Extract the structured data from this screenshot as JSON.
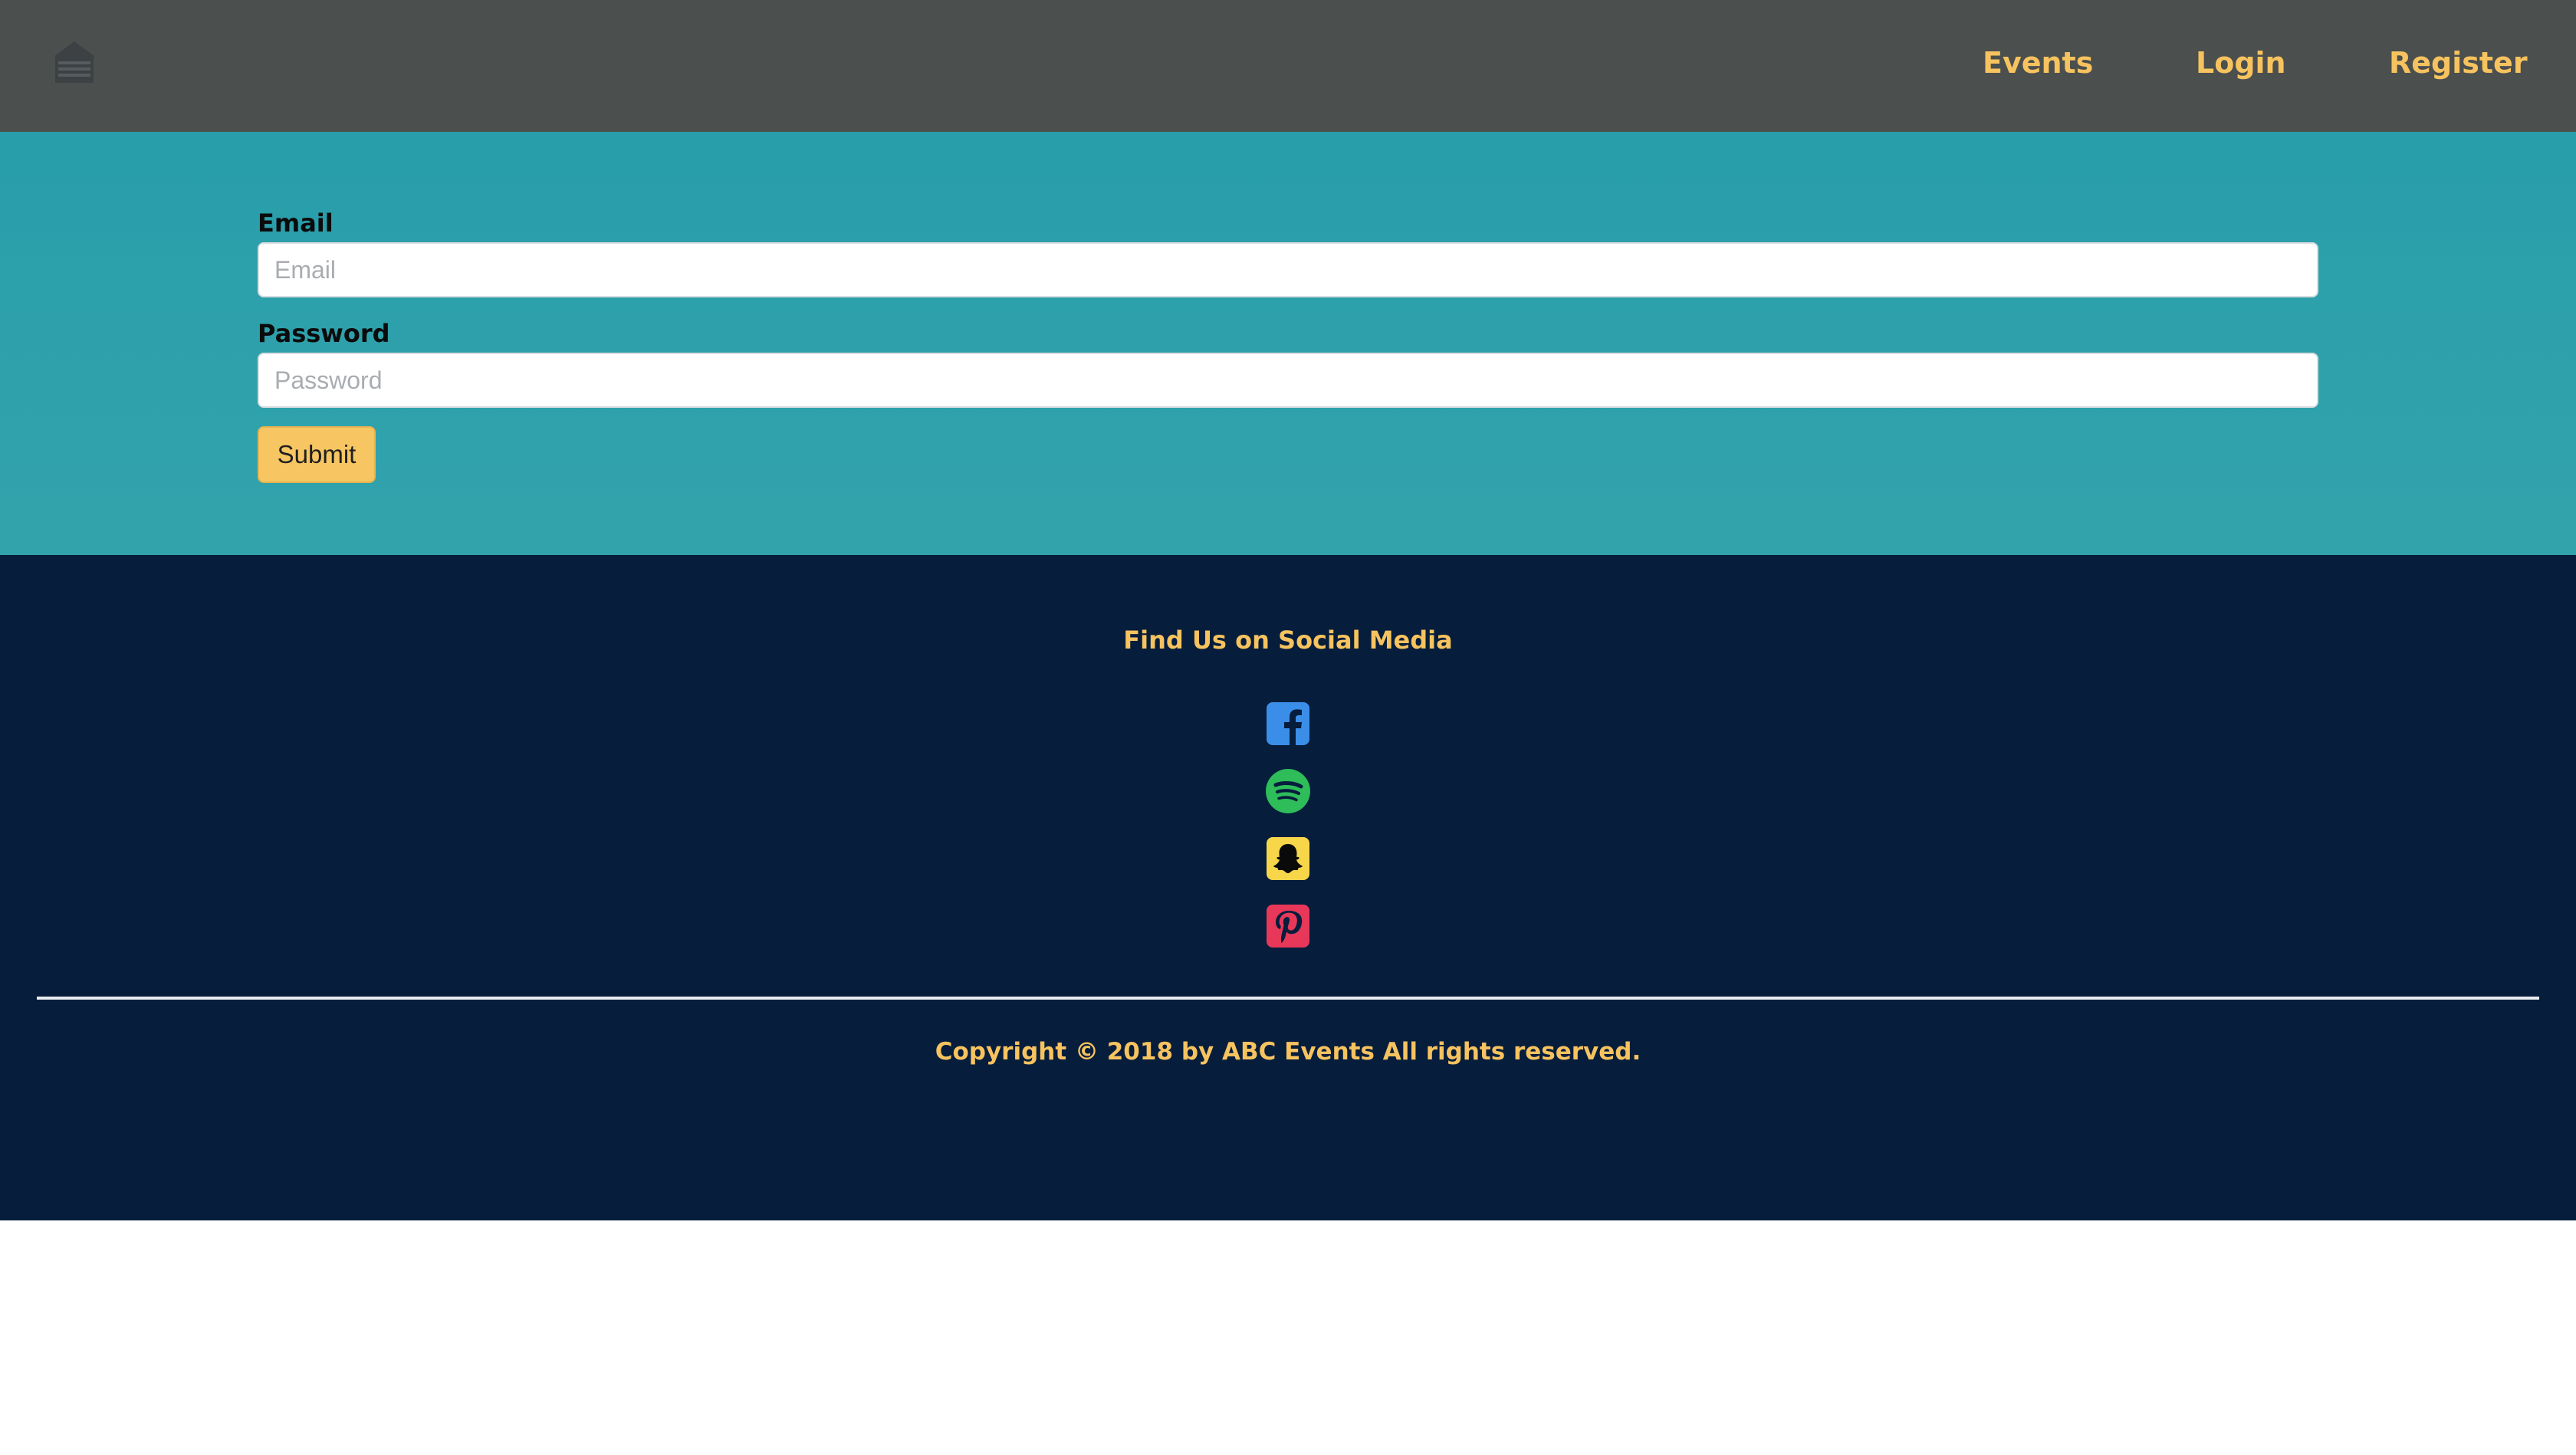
{
  "navbar": {
    "logo_icon": "home-icon",
    "links": {
      "events": "Events",
      "login": "Login",
      "register": "Register"
    },
    "link_color": "#f7c35f",
    "background": "#4b4f4e"
  },
  "login_form": {
    "email": {
      "label": "Email",
      "placeholder": "Email",
      "value": ""
    },
    "password": {
      "label": "Password",
      "placeholder": "Password",
      "value": ""
    },
    "submit_label": "Submit",
    "background": "#2a9fab",
    "button_color": "#f7c662"
  },
  "footer": {
    "social_heading": "Find Us on Social Media",
    "social_icons": [
      "facebook-icon",
      "spotify-icon",
      "snapchat-icon",
      "pinterest-icon"
    ],
    "copyright": "Copyright © 2018 by ABC Events All rights reserved.",
    "background": "#061d3c",
    "text_color": "#f7c35f"
  }
}
